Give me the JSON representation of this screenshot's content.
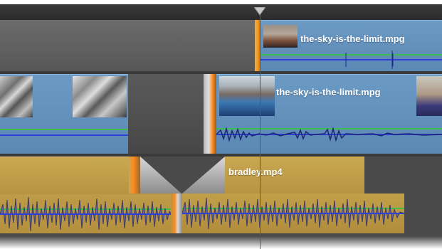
{
  "timeline": {
    "colors": {
      "video_clip": "#5f8fbb",
      "audio_clip": "#b9963f",
      "playhead": "#e02020",
      "gap": "#4a4a4a",
      "volume_line": "#2f3fd8",
      "pan_line": "#3fbf4a",
      "trim_marker": "#ff8a1e"
    },
    "playhead": {
      "icon": "playhead-triangle-icon"
    },
    "tracks": [
      {
        "id": "track-1",
        "clips": [
          {
            "name": "the-sky-is-the-limit.mpg",
            "kind": "video"
          }
        ]
      },
      {
        "id": "track-2",
        "clips": [
          {
            "name": "",
            "kind": "video"
          },
          {
            "name": "the-sky-is-the-limit.mpg",
            "kind": "video"
          }
        ]
      },
      {
        "id": "track-3",
        "clips": [
          {
            "name": "",
            "kind": "audio"
          },
          {
            "name": "bradley.mp4",
            "kind": "audio"
          }
        ]
      }
    ]
  }
}
